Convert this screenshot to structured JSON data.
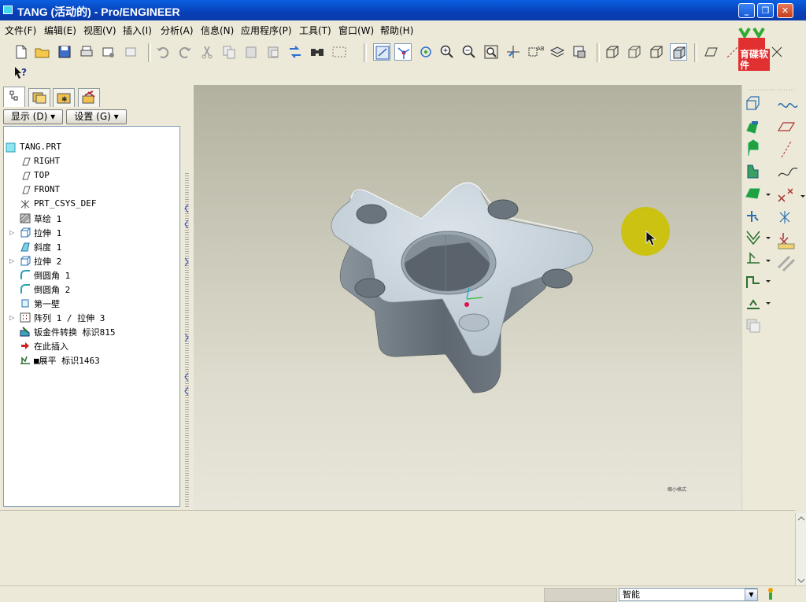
{
  "window": {
    "title": "TANG (活动的) - Pro/ENGINEER",
    "minimize": "_",
    "maximize": "❐",
    "close": "✕"
  },
  "menu": [
    "文件(F)",
    "编辑(E)",
    "视图(V)",
    "插入(I)",
    "分析(A)",
    "信息(N)",
    "应用程序(P)",
    "工具(T)",
    "窗口(W)",
    "帮助(H)"
  ],
  "logo": {
    "text": "育碟软件"
  },
  "panel": {
    "show_button": "显示 (D) ▾",
    "settings_button": "设置 (G) ▾"
  },
  "tree": {
    "root": "TANG.PRT",
    "items": [
      {
        "label": "RIGHT",
        "icon": "datum-plane-icon"
      },
      {
        "label": "TOP",
        "icon": "datum-plane-icon"
      },
      {
        "label": "FRONT",
        "icon": "datum-plane-icon"
      },
      {
        "label": "PRT_CSYS_DEF",
        "icon": "csys-icon"
      },
      {
        "label": "草绘 1",
        "icon": "sketch-icon"
      },
      {
        "label": "拉伸 1",
        "icon": "extrude-icon"
      },
      {
        "label": "斜度 1",
        "icon": "draft-icon"
      },
      {
        "label": "拉伸 2",
        "icon": "extrude-icon"
      },
      {
        "label": "倒圆角 1",
        "icon": "round-icon"
      },
      {
        "label": "倒圆角 2",
        "icon": "round-icon"
      },
      {
        "label": "第一壁",
        "icon": "first-wall-icon"
      },
      {
        "label": "阵列 1 / 拉伸 3",
        "icon": "pattern-icon"
      },
      {
        "label": "钣金件转换 标识815",
        "icon": "sheetmetal-convert-icon"
      },
      {
        "label": "在此插入",
        "icon": "insert-here-arrow-icon"
      },
      {
        "label": "■展平 标识1463",
        "icon": "flat-pattern-icon"
      }
    ]
  },
  "viewport": {
    "corner_label": "缩小格式"
  },
  "status": {
    "filter_value": "智能"
  },
  "colors": {
    "titlebar": "#0a46c8",
    "model_top": "#c5d0da",
    "model_side": "#6c7680",
    "cursor_highlight": "#c8c000"
  }
}
